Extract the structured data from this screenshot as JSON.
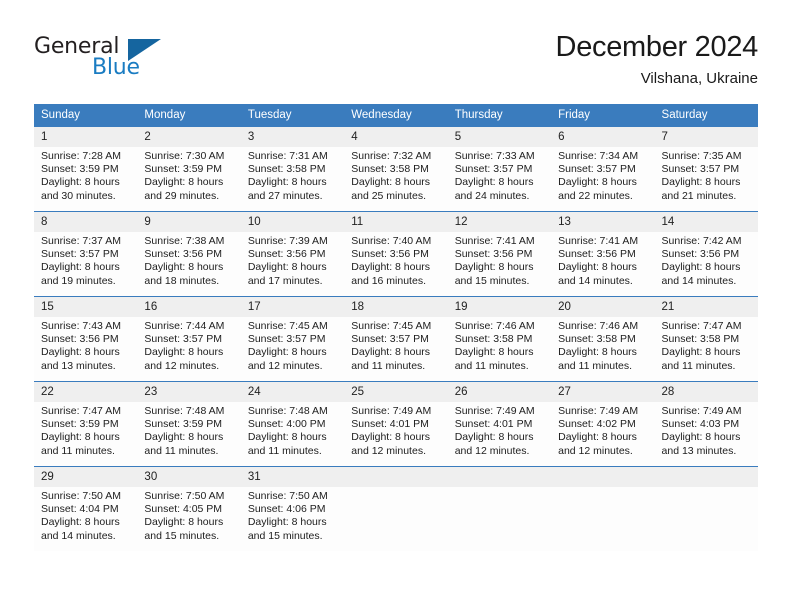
{
  "brand": {
    "name_part1": "General",
    "name_part2": "Blue",
    "triangle_icon": "blue-triangle-icon",
    "accent_color": "#1a7cc2"
  },
  "header": {
    "title": "December 2024",
    "location": "Vilshana, Ukraine"
  },
  "theme": {
    "header_bg": "#3a7cbe",
    "day_band_bg": "#efefef",
    "cell_bg": "#fdfdfd",
    "text": "#1d1d1d"
  },
  "calendar": {
    "weekday_headers": [
      "Sunday",
      "Monday",
      "Tuesday",
      "Wednesday",
      "Thursday",
      "Friday",
      "Saturday"
    ],
    "weeks": [
      [
        {
          "day": "1",
          "sunrise": "Sunrise: 7:28 AM",
          "sunset": "Sunset: 3:59 PM",
          "daylight_line1": "Daylight: 8 hours",
          "daylight_line2": "and 30 minutes."
        },
        {
          "day": "2",
          "sunrise": "Sunrise: 7:30 AM",
          "sunset": "Sunset: 3:59 PM",
          "daylight_line1": "Daylight: 8 hours",
          "daylight_line2": "and 29 minutes."
        },
        {
          "day": "3",
          "sunrise": "Sunrise: 7:31 AM",
          "sunset": "Sunset: 3:58 PM",
          "daylight_line1": "Daylight: 8 hours",
          "daylight_line2": "and 27 minutes."
        },
        {
          "day": "4",
          "sunrise": "Sunrise: 7:32 AM",
          "sunset": "Sunset: 3:58 PM",
          "daylight_line1": "Daylight: 8 hours",
          "daylight_line2": "and 25 minutes."
        },
        {
          "day": "5",
          "sunrise": "Sunrise: 7:33 AM",
          "sunset": "Sunset: 3:57 PM",
          "daylight_line1": "Daylight: 8 hours",
          "daylight_line2": "and 24 minutes."
        },
        {
          "day": "6",
          "sunrise": "Sunrise: 7:34 AM",
          "sunset": "Sunset: 3:57 PM",
          "daylight_line1": "Daylight: 8 hours",
          "daylight_line2": "and 22 minutes."
        },
        {
          "day": "7",
          "sunrise": "Sunrise: 7:35 AM",
          "sunset": "Sunset: 3:57 PM",
          "daylight_line1": "Daylight: 8 hours",
          "daylight_line2": "and 21 minutes."
        }
      ],
      [
        {
          "day": "8",
          "sunrise": "Sunrise: 7:37 AM",
          "sunset": "Sunset: 3:57 PM",
          "daylight_line1": "Daylight: 8 hours",
          "daylight_line2": "and 19 minutes."
        },
        {
          "day": "9",
          "sunrise": "Sunrise: 7:38 AM",
          "sunset": "Sunset: 3:56 PM",
          "daylight_line1": "Daylight: 8 hours",
          "daylight_line2": "and 18 minutes."
        },
        {
          "day": "10",
          "sunrise": "Sunrise: 7:39 AM",
          "sunset": "Sunset: 3:56 PM",
          "daylight_line1": "Daylight: 8 hours",
          "daylight_line2": "and 17 minutes."
        },
        {
          "day": "11",
          "sunrise": "Sunrise: 7:40 AM",
          "sunset": "Sunset: 3:56 PM",
          "daylight_line1": "Daylight: 8 hours",
          "daylight_line2": "and 16 minutes."
        },
        {
          "day": "12",
          "sunrise": "Sunrise: 7:41 AM",
          "sunset": "Sunset: 3:56 PM",
          "daylight_line1": "Daylight: 8 hours",
          "daylight_line2": "and 15 minutes."
        },
        {
          "day": "13",
          "sunrise": "Sunrise: 7:41 AM",
          "sunset": "Sunset: 3:56 PM",
          "daylight_line1": "Daylight: 8 hours",
          "daylight_line2": "and 14 minutes."
        },
        {
          "day": "14",
          "sunrise": "Sunrise: 7:42 AM",
          "sunset": "Sunset: 3:56 PM",
          "daylight_line1": "Daylight: 8 hours",
          "daylight_line2": "and 14 minutes."
        }
      ],
      [
        {
          "day": "15",
          "sunrise": "Sunrise: 7:43 AM",
          "sunset": "Sunset: 3:56 PM",
          "daylight_line1": "Daylight: 8 hours",
          "daylight_line2": "and 13 minutes."
        },
        {
          "day": "16",
          "sunrise": "Sunrise: 7:44 AM",
          "sunset": "Sunset: 3:57 PM",
          "daylight_line1": "Daylight: 8 hours",
          "daylight_line2": "and 12 minutes."
        },
        {
          "day": "17",
          "sunrise": "Sunrise: 7:45 AM",
          "sunset": "Sunset: 3:57 PM",
          "daylight_line1": "Daylight: 8 hours",
          "daylight_line2": "and 12 minutes."
        },
        {
          "day": "18",
          "sunrise": "Sunrise: 7:45 AM",
          "sunset": "Sunset: 3:57 PM",
          "daylight_line1": "Daylight: 8 hours",
          "daylight_line2": "and 11 minutes."
        },
        {
          "day": "19",
          "sunrise": "Sunrise: 7:46 AM",
          "sunset": "Sunset: 3:58 PM",
          "daylight_line1": "Daylight: 8 hours",
          "daylight_line2": "and 11 minutes."
        },
        {
          "day": "20",
          "sunrise": "Sunrise: 7:46 AM",
          "sunset": "Sunset: 3:58 PM",
          "daylight_line1": "Daylight: 8 hours",
          "daylight_line2": "and 11 minutes."
        },
        {
          "day": "21",
          "sunrise": "Sunrise: 7:47 AM",
          "sunset": "Sunset: 3:58 PM",
          "daylight_line1": "Daylight: 8 hours",
          "daylight_line2": "and 11 minutes."
        }
      ],
      [
        {
          "day": "22",
          "sunrise": "Sunrise: 7:47 AM",
          "sunset": "Sunset: 3:59 PM",
          "daylight_line1": "Daylight: 8 hours",
          "daylight_line2": "and 11 minutes."
        },
        {
          "day": "23",
          "sunrise": "Sunrise: 7:48 AM",
          "sunset": "Sunset: 3:59 PM",
          "daylight_line1": "Daylight: 8 hours",
          "daylight_line2": "and 11 minutes."
        },
        {
          "day": "24",
          "sunrise": "Sunrise: 7:48 AM",
          "sunset": "Sunset: 4:00 PM",
          "daylight_line1": "Daylight: 8 hours",
          "daylight_line2": "and 11 minutes."
        },
        {
          "day": "25",
          "sunrise": "Sunrise: 7:49 AM",
          "sunset": "Sunset: 4:01 PM",
          "daylight_line1": "Daylight: 8 hours",
          "daylight_line2": "and 12 minutes."
        },
        {
          "day": "26",
          "sunrise": "Sunrise: 7:49 AM",
          "sunset": "Sunset: 4:01 PM",
          "daylight_line1": "Daylight: 8 hours",
          "daylight_line2": "and 12 minutes."
        },
        {
          "day": "27",
          "sunrise": "Sunrise: 7:49 AM",
          "sunset": "Sunset: 4:02 PM",
          "daylight_line1": "Daylight: 8 hours",
          "daylight_line2": "and 12 minutes."
        },
        {
          "day": "28",
          "sunrise": "Sunrise: 7:49 AM",
          "sunset": "Sunset: 4:03 PM",
          "daylight_line1": "Daylight: 8 hours",
          "daylight_line2": "and 13 minutes."
        }
      ],
      [
        {
          "day": "29",
          "sunrise": "Sunrise: 7:50 AM",
          "sunset": "Sunset: 4:04 PM",
          "daylight_line1": "Daylight: 8 hours",
          "daylight_line2": "and 14 minutes."
        },
        {
          "day": "30",
          "sunrise": "Sunrise: 7:50 AM",
          "sunset": "Sunset: 4:05 PM",
          "daylight_line1": "Daylight: 8 hours",
          "daylight_line2": "and 15 minutes."
        },
        {
          "day": "31",
          "sunrise": "Sunrise: 7:50 AM",
          "sunset": "Sunset: 4:06 PM",
          "daylight_line1": "Daylight: 8 hours",
          "daylight_line2": "and 15 minutes."
        },
        {
          "day": "",
          "sunrise": "",
          "sunset": "",
          "daylight_line1": "",
          "daylight_line2": ""
        },
        {
          "day": "",
          "sunrise": "",
          "sunset": "",
          "daylight_line1": "",
          "daylight_line2": ""
        },
        {
          "day": "",
          "sunrise": "",
          "sunset": "",
          "daylight_line1": "",
          "daylight_line2": ""
        },
        {
          "day": "",
          "sunrise": "",
          "sunset": "",
          "daylight_line1": "",
          "daylight_line2": ""
        }
      ]
    ]
  }
}
